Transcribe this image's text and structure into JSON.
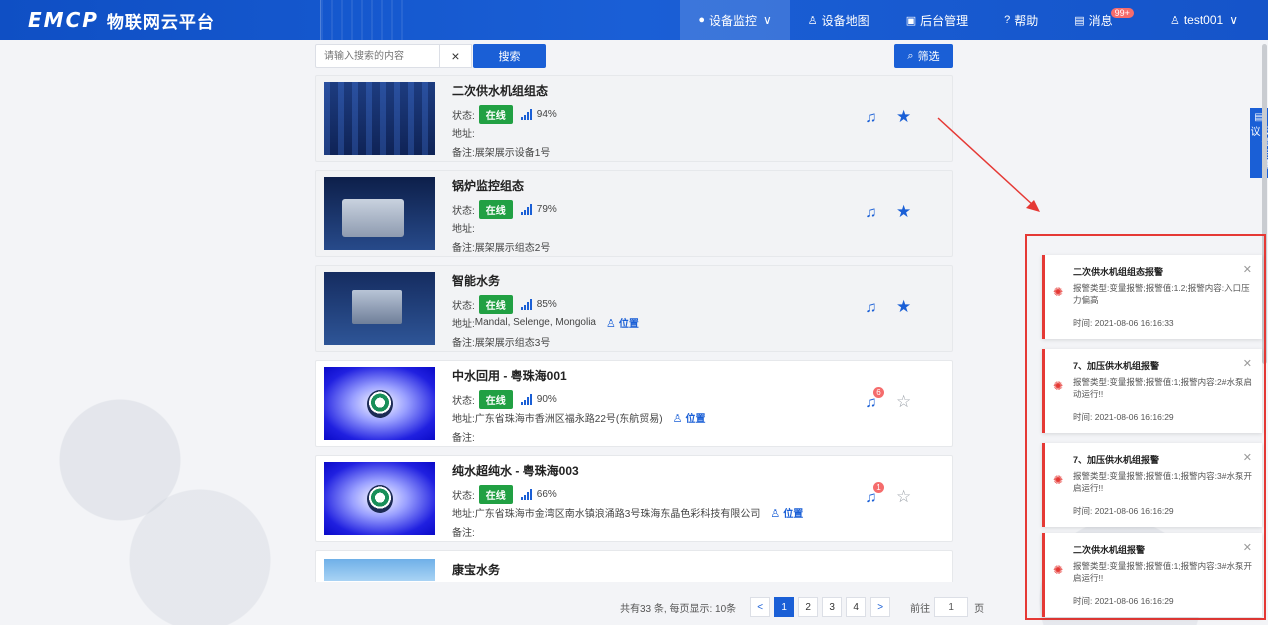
{
  "header": {
    "logo_mark": "EMCP",
    "logo_text": "物联网云平台",
    "nav": [
      {
        "icon": "monitor-icon",
        "label": "设备监控",
        "suffix": "∨",
        "active": true
      },
      {
        "icon": "map-icon",
        "label": "设备地图"
      },
      {
        "icon": "admin-icon",
        "label": "后台管理"
      },
      {
        "icon": "help-icon",
        "label": "帮助"
      },
      {
        "icon": "message-icon",
        "label": "消息",
        "badge": "99+"
      },
      {
        "icon": "user-icon",
        "label": "test001",
        "suffix": "∨"
      }
    ]
  },
  "search": {
    "placeholder": "请输入搜索的内容",
    "clear_label": "×",
    "search_label": "搜索",
    "filter_label": "筛选"
  },
  "labels": {
    "status": "状态:",
    "address": "地址:",
    "remark": "备注:",
    "location": "位置"
  },
  "devices": [
    {
      "title": "二次供水机组组态",
      "status": "在线",
      "signal": "94%",
      "address": "",
      "remark": "展架展示设备1号",
      "alarm": "",
      "starred": true,
      "thumb": "scada"
    },
    {
      "title": "锅炉监控组态",
      "status": "在线",
      "signal": "79%",
      "address": "",
      "remark": "展架展示组态2号",
      "alarm": "",
      "starred": true,
      "thumb": "boiler"
    },
    {
      "title": "智能水务",
      "status": "在线",
      "signal": "85%",
      "address": "Mandal, Selenge, Mongolia",
      "remark": "展架展示组态3号",
      "alarm": "",
      "starred": true,
      "thumb": "water"
    },
    {
      "title": "中水回用 - 粤珠海001",
      "status": "在线",
      "signal": "90%",
      "address": "广东省珠海市香洲区福永路22号(东航贸易)",
      "remark": "",
      "alarm": "6",
      "starred": false,
      "thumb": "logo"
    },
    {
      "title": "纯水超纯水 - 粤珠海003",
      "status": "在线",
      "signal": "66%",
      "address": "广东省珠海市金湾区南水镇浪涌路3号珠海东晶色彩科技有限公司",
      "remark": "",
      "alarm": "1",
      "starred": false,
      "thumb": "logo"
    },
    {
      "title": "康宝水务",
      "thumb": "partial"
    }
  ],
  "pager": {
    "total_text": "共有33 条, 每页显示: 10条",
    "prev": "<",
    "pages": [
      "1",
      "2",
      "3",
      "4"
    ],
    "next": ">",
    "goto_label": "前往",
    "goto_value": "1",
    "unit": "页"
  },
  "feedback": {
    "label": "反馈与建议"
  },
  "alerts": [
    {
      "title": "二次供水机组组态报警",
      "body": "报警类型:变量报警;报警值:1.2;报警内容:入口压力偏高",
      "time": "时间: 2021-08-06 16:16:33"
    },
    {
      "title": "7、加压供水机组报警",
      "body": "报警类型:变量报警;报警值:1;报警内容:2#水泵启动运行!!",
      "time": "时间: 2021-08-06 16:16:29"
    },
    {
      "title": "7、加压供水机组报警",
      "body": "报警类型:变量报警;报警值:1;报警内容:3#水泵开启运行!!",
      "time": "时间: 2021-08-06 16:16:29"
    },
    {
      "title": "二次供水机组报警",
      "body": "报警类型:变量报警;报警值:1;报警内容:3#水泵开启运行!!",
      "time": "时间: 2021-08-06 16:16:29"
    }
  ],
  "colors": {
    "primary": "#1a5fd6",
    "online": "#21a043",
    "alert": "#e53935"
  }
}
